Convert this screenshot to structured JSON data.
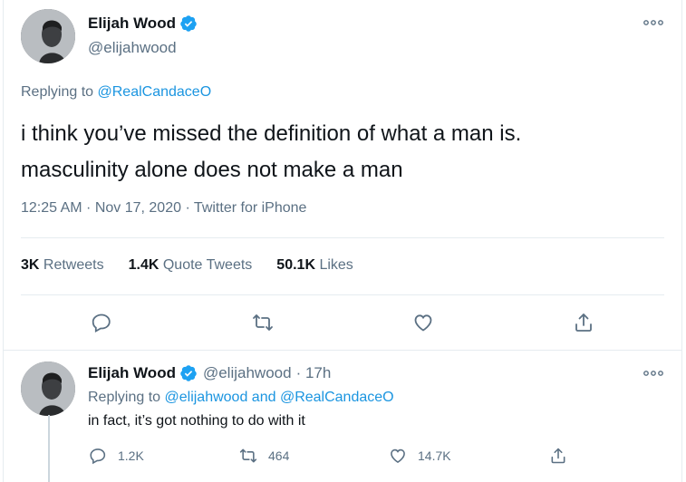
{
  "main_tweet": {
    "author_name": "Elijah Wood",
    "author_handle": "@elijahwood",
    "replying_prefix": "Replying to ",
    "replying_to": "@RealCandaceO",
    "text_line1": "i think you’ve missed the definition of what a man is.",
    "text_line2": "masculinity alone does not make a man",
    "meta": "12:25 AM · Nov 17, 2020 · Twitter for iPhone",
    "stats": {
      "retweets_count": "3K",
      "retweets_label": "Retweets",
      "quote_count": "1.4K",
      "quote_label": "Quote Tweets",
      "likes_count": "50.1K",
      "likes_label": "Likes"
    }
  },
  "reply_tweet": {
    "author_name": "Elijah Wood",
    "author_handle": "@elijahwood",
    "time": "· 17h",
    "replying_prefix": "Replying to ",
    "replying_to_1": "@elijahwood",
    "replying_and": " and ",
    "replying_to_2": "@RealCandaceO",
    "text": "in fact, it’s got nothing to do with it",
    "actions": {
      "reply_count": "1.2K",
      "retweet_count": "464",
      "like_count": "14.7K"
    }
  },
  "colors": {
    "accent": "#1da1f2",
    "link": "#1b95e0",
    "secondary_text": "#5b7083",
    "divider": "#e6ecf0"
  },
  "icons": [
    "verified-badge-icon",
    "more-icon",
    "reply-icon",
    "retweet-icon",
    "like-icon",
    "share-icon"
  ]
}
